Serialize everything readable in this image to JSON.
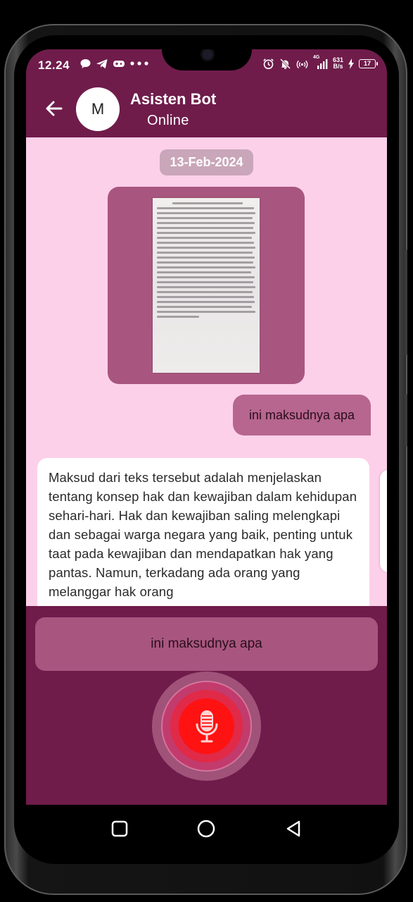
{
  "status_bar": {
    "time": "12.24",
    "left_icons": [
      "chat-bubble-icon",
      "telegram-icon",
      "gamepad-icon",
      "more-dots-icon"
    ],
    "right_icons": [
      "alarm-icon",
      "mute-bell-icon",
      "hotspot-icon",
      "signal-4g-icon"
    ],
    "net_speed_value": "631",
    "net_speed_unit": "B/s",
    "network_type": "4G",
    "battery_level": "17"
  },
  "header": {
    "avatar_letter": "M",
    "bot_name": "Asisten Bot",
    "bot_status": "Online"
  },
  "chat": {
    "date_label": "13-Feb-2024",
    "sent_message": "ini maksudnya apa",
    "reply": "Maksud dari teks tersebut adalah menjelaskan tentang konsep hak dan kewajiban dalam kehidupan sehari-hari. Hak dan kewajiban saling melengkapi dan sebagai warga negara yang baik, penting untuk taat pada kewajiban dan mendapatkan hak yang pantas. Namun, terkadang ada orang yang melanggar hak orang"
  },
  "input": {
    "transcript": "ini maksudnya apa"
  },
  "colors": {
    "primary": "#6f1c4b",
    "chat_background": "#fdd0ea",
    "sent_bubble": "#b7668f",
    "mic_red": "#ff1212"
  }
}
